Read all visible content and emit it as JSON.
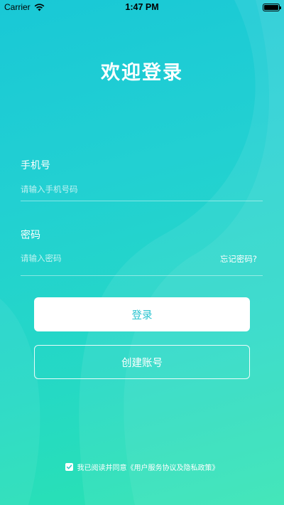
{
  "status_bar": {
    "carrier": "Carrier",
    "time": "1:47 PM",
    "wifi_icon": "wifi-icon",
    "battery_icon": "battery-icon",
    "battery_level": 1.0
  },
  "title": "欢迎登录",
  "phone": {
    "label": "手机号",
    "placeholder": "请输入手机号码",
    "value": ""
  },
  "password": {
    "label": "密码",
    "placeholder": "请输入密码",
    "value": "",
    "forgot_label": "忘记密码?"
  },
  "buttons": {
    "login_label": "登录",
    "create_label": "创建账号"
  },
  "agreement": {
    "checked": true,
    "checkbox_icon": "checkmark-icon",
    "text": "我已阅读并同意《用户服务协议及隐私政策》"
  },
  "colors": {
    "gradient_top": "#19c8d6",
    "gradient_bottom": "#2ae3b0",
    "login_text": "#27c3cf",
    "foreground": "#ffffff"
  }
}
